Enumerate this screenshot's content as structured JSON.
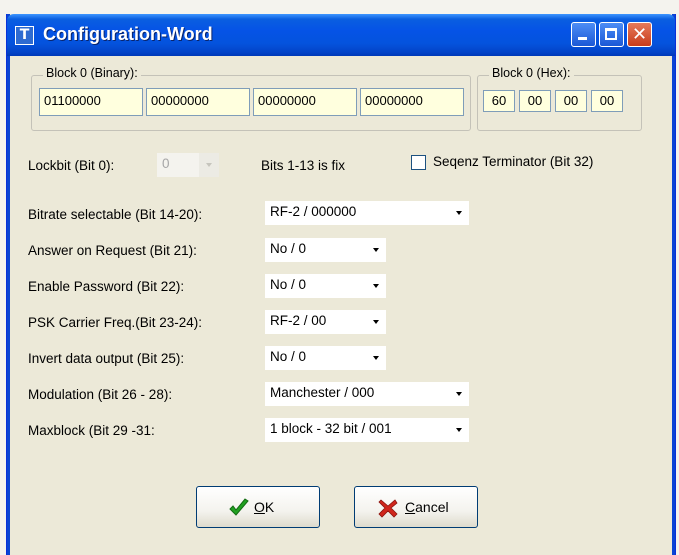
{
  "window": {
    "title": "Configuration-Word",
    "icon": "T"
  },
  "binary_group": {
    "legend": "Block 0 (Binary):",
    "fields": [
      "01100000",
      "00000000",
      "00000000",
      "00000000"
    ]
  },
  "hex_group": {
    "legend": "Block 0 (Hex):",
    "fields": [
      "60",
      "00",
      "00",
      "00"
    ]
  },
  "lockbit": {
    "label": "Lockbit (Bit 0):",
    "value": "0"
  },
  "bits_fix_note": "Bits 1-13 is fix",
  "seq_terminator": {
    "label": "Seqenz Terminator (Bit 32)",
    "checked": false
  },
  "settings": [
    {
      "label": "Bitrate selectable (Bit 14-20):",
      "value": "RF-2 / 000000"
    },
    {
      "label": "Answer on Request (Bit 21):",
      "value": "No / 0"
    },
    {
      "label": "Enable Password (Bit 22):",
      "value": "No / 0"
    },
    {
      "label": "PSK Carrier Freq.(Bit 23-24):",
      "value": "RF-2 / 00"
    },
    {
      "label": "Invert data output (Bit 25):",
      "value": "No / 0"
    },
    {
      "label": "Modulation (Bit 26 - 28):",
      "value": "Manchester / 000"
    },
    {
      "label": "Maxblock (Bit 29 -31:",
      "value": "1 block - 32 bit / 001"
    }
  ],
  "buttons": {
    "ok": {
      "accel": "O",
      "rest": "K"
    },
    "cancel": {
      "accel": "C",
      "rest": "ancel"
    }
  },
  "colors": {
    "field_bg": "#ffffde",
    "window_bg": "#ece9d8",
    "title_blue": "#0553e6",
    "close_red": "#c73c1c",
    "ok_check": "#21a121",
    "cancel_x": "#d0261c"
  }
}
